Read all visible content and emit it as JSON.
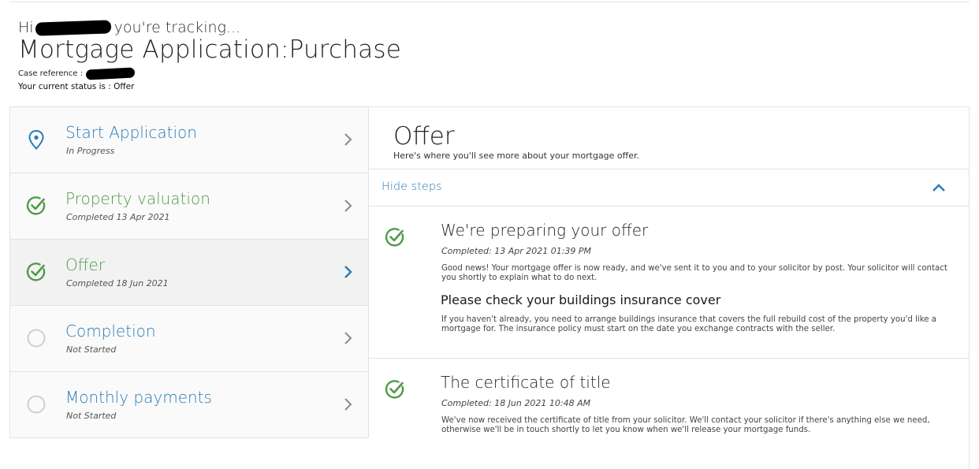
{
  "header": {
    "greeting_start": "Hi",
    "greeting_end": "you're tracking...",
    "title": "Mortgage Application:Purchase",
    "case_label": "Case reference :",
    "status_text": "Your current status is : Offer"
  },
  "steps": [
    {
      "label": "Start Application",
      "sub": "In Progress",
      "state": "in-progress",
      "icon": "location-pin-icon"
    },
    {
      "label": "Property valuation",
      "sub": "Completed 13 Apr 2021",
      "state": "completed",
      "icon": "check-circle-icon"
    },
    {
      "label": "Offer",
      "sub": "Completed 18 Jun 2021",
      "state": "completed-active",
      "icon": "check-circle-icon"
    },
    {
      "label": "Completion",
      "sub": "Not Started",
      "state": "not-started",
      "icon": "empty-circle-icon"
    },
    {
      "label": "Monthly payments",
      "sub": "Not Started",
      "state": "not-started",
      "icon": "empty-circle-icon"
    }
  ],
  "content": {
    "title": "Offer",
    "subtitle": "Here's where you'll see more about your mortgage offer.",
    "hide_steps_label": "Hide steps",
    "items": [
      {
        "title": "We're preparing your offer",
        "date": "Completed: 13 Apr 2021 01:39 PM",
        "text": "Good news! Your mortgage offer is now ready, and we've sent it to you and to your solicitor by post. Your solicitor will contact you shortly to explain what to do next.",
        "subheading": "Please check your buildings insurance cover",
        "subtext": "If you haven't already, you need to arrange buildings insurance that covers the full rebuild cost of the property you'd like a mortgage for. The insurance policy must start on the date you exchange contracts with the seller."
      },
      {
        "title": "The certificate of title",
        "date": "Completed: 18 Jun 2021 10:48 AM",
        "text": "We've now received the certificate of title from your solicitor. We'll contact your solicitor if there's anything else we need, otherwise we'll be in touch shortly to let you know when we'll release your mortgage funds."
      }
    ]
  },
  "colors": {
    "blue": "#2a7cb8",
    "green": "#4e9a48",
    "grey_circle": "#cfcfcf"
  }
}
